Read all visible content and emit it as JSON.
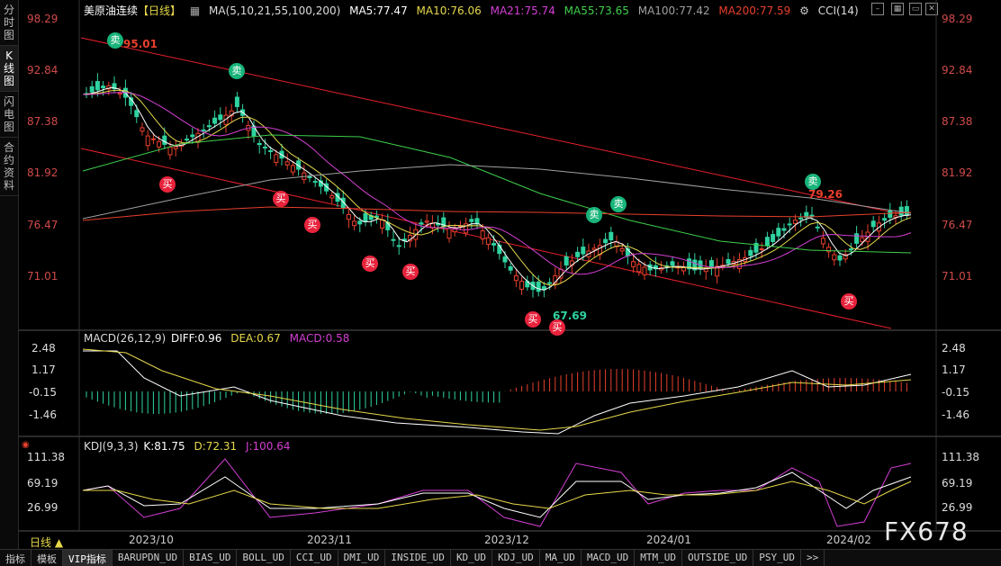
{
  "sidebar": [
    "分\n时\n图",
    "K\n线\n图",
    "闪\n电\n图",
    "合\n约\n资\n料"
  ],
  "main": {
    "title": "美原油连续",
    "period_tag": "【日线】",
    "ma_label": "MA(5,10,21,55,100,200)",
    "ma_values": [
      {
        "text": "MA5:77.47",
        "color": "#ffffff"
      },
      {
        "text": "MA10:76.06",
        "color": "#e6d84a"
      },
      {
        "text": "MA21:75.74",
        "color": "#d43fd4"
      },
      {
        "text": "MA55:73.65",
        "color": "#3ecf4c"
      },
      {
        "text": "MA100:77.42",
        "color": "#a0a0a0"
      },
      {
        "text": "MA200:77.59",
        "color": "#e8402c"
      }
    ],
    "cci_label": "CCI(14)",
    "y_ticks": [
      "98.29",
      "92.84",
      "87.38",
      "81.92",
      "76.47",
      "71.01"
    ],
    "annotations": {
      "high": "95.01",
      "low": "67.69",
      "mid_high": "79.26"
    },
    "sell_label": "卖",
    "buy_label": "买"
  },
  "macd": {
    "label": "MACD(26,12,9)",
    "diff": "DIFF:0.96",
    "dea": "DEA:0.67",
    "macd": "MACD:0.58",
    "y_ticks": [
      "2.48",
      "1.17",
      "-0.15",
      "-1.46"
    ]
  },
  "kdj": {
    "label": "KDJ(9,3,3)",
    "k": "K:81.75",
    "d": "D:72.31",
    "j": "J:100.64",
    "y_ticks": [
      "111.38",
      "69.19",
      "26.99"
    ]
  },
  "x_axis": [
    "2023/10",
    "2023/11",
    "2023/12",
    "2024/01",
    "2024/02"
  ],
  "period_selector": "日线",
  "watermark": "FX678",
  "bottom_tabs": [
    "指标",
    "模板",
    "VIP指标",
    "BARUPDN_UD",
    "BIAS_UD",
    "BOLL_UD",
    "CCI_UD",
    "DMI_UD",
    "INSIDE_UD",
    "KD_UD",
    "KDJ_UD",
    "MA_UD",
    "MACD_UD",
    "MTM_UD",
    "OUTSIDE_UD",
    "PSY_UD",
    ">>"
  ],
  "colors": {
    "up": "#e8402c",
    "down": "#2fd3a0",
    "channel": "#e8202c",
    "ma5": "#ffffff",
    "ma10": "#e6d84a",
    "ma21": "#d43fd4",
    "ma55": "#3ecf4c",
    "ma100": "#a0a0a0",
    "ma200": "#e8402c"
  }
}
